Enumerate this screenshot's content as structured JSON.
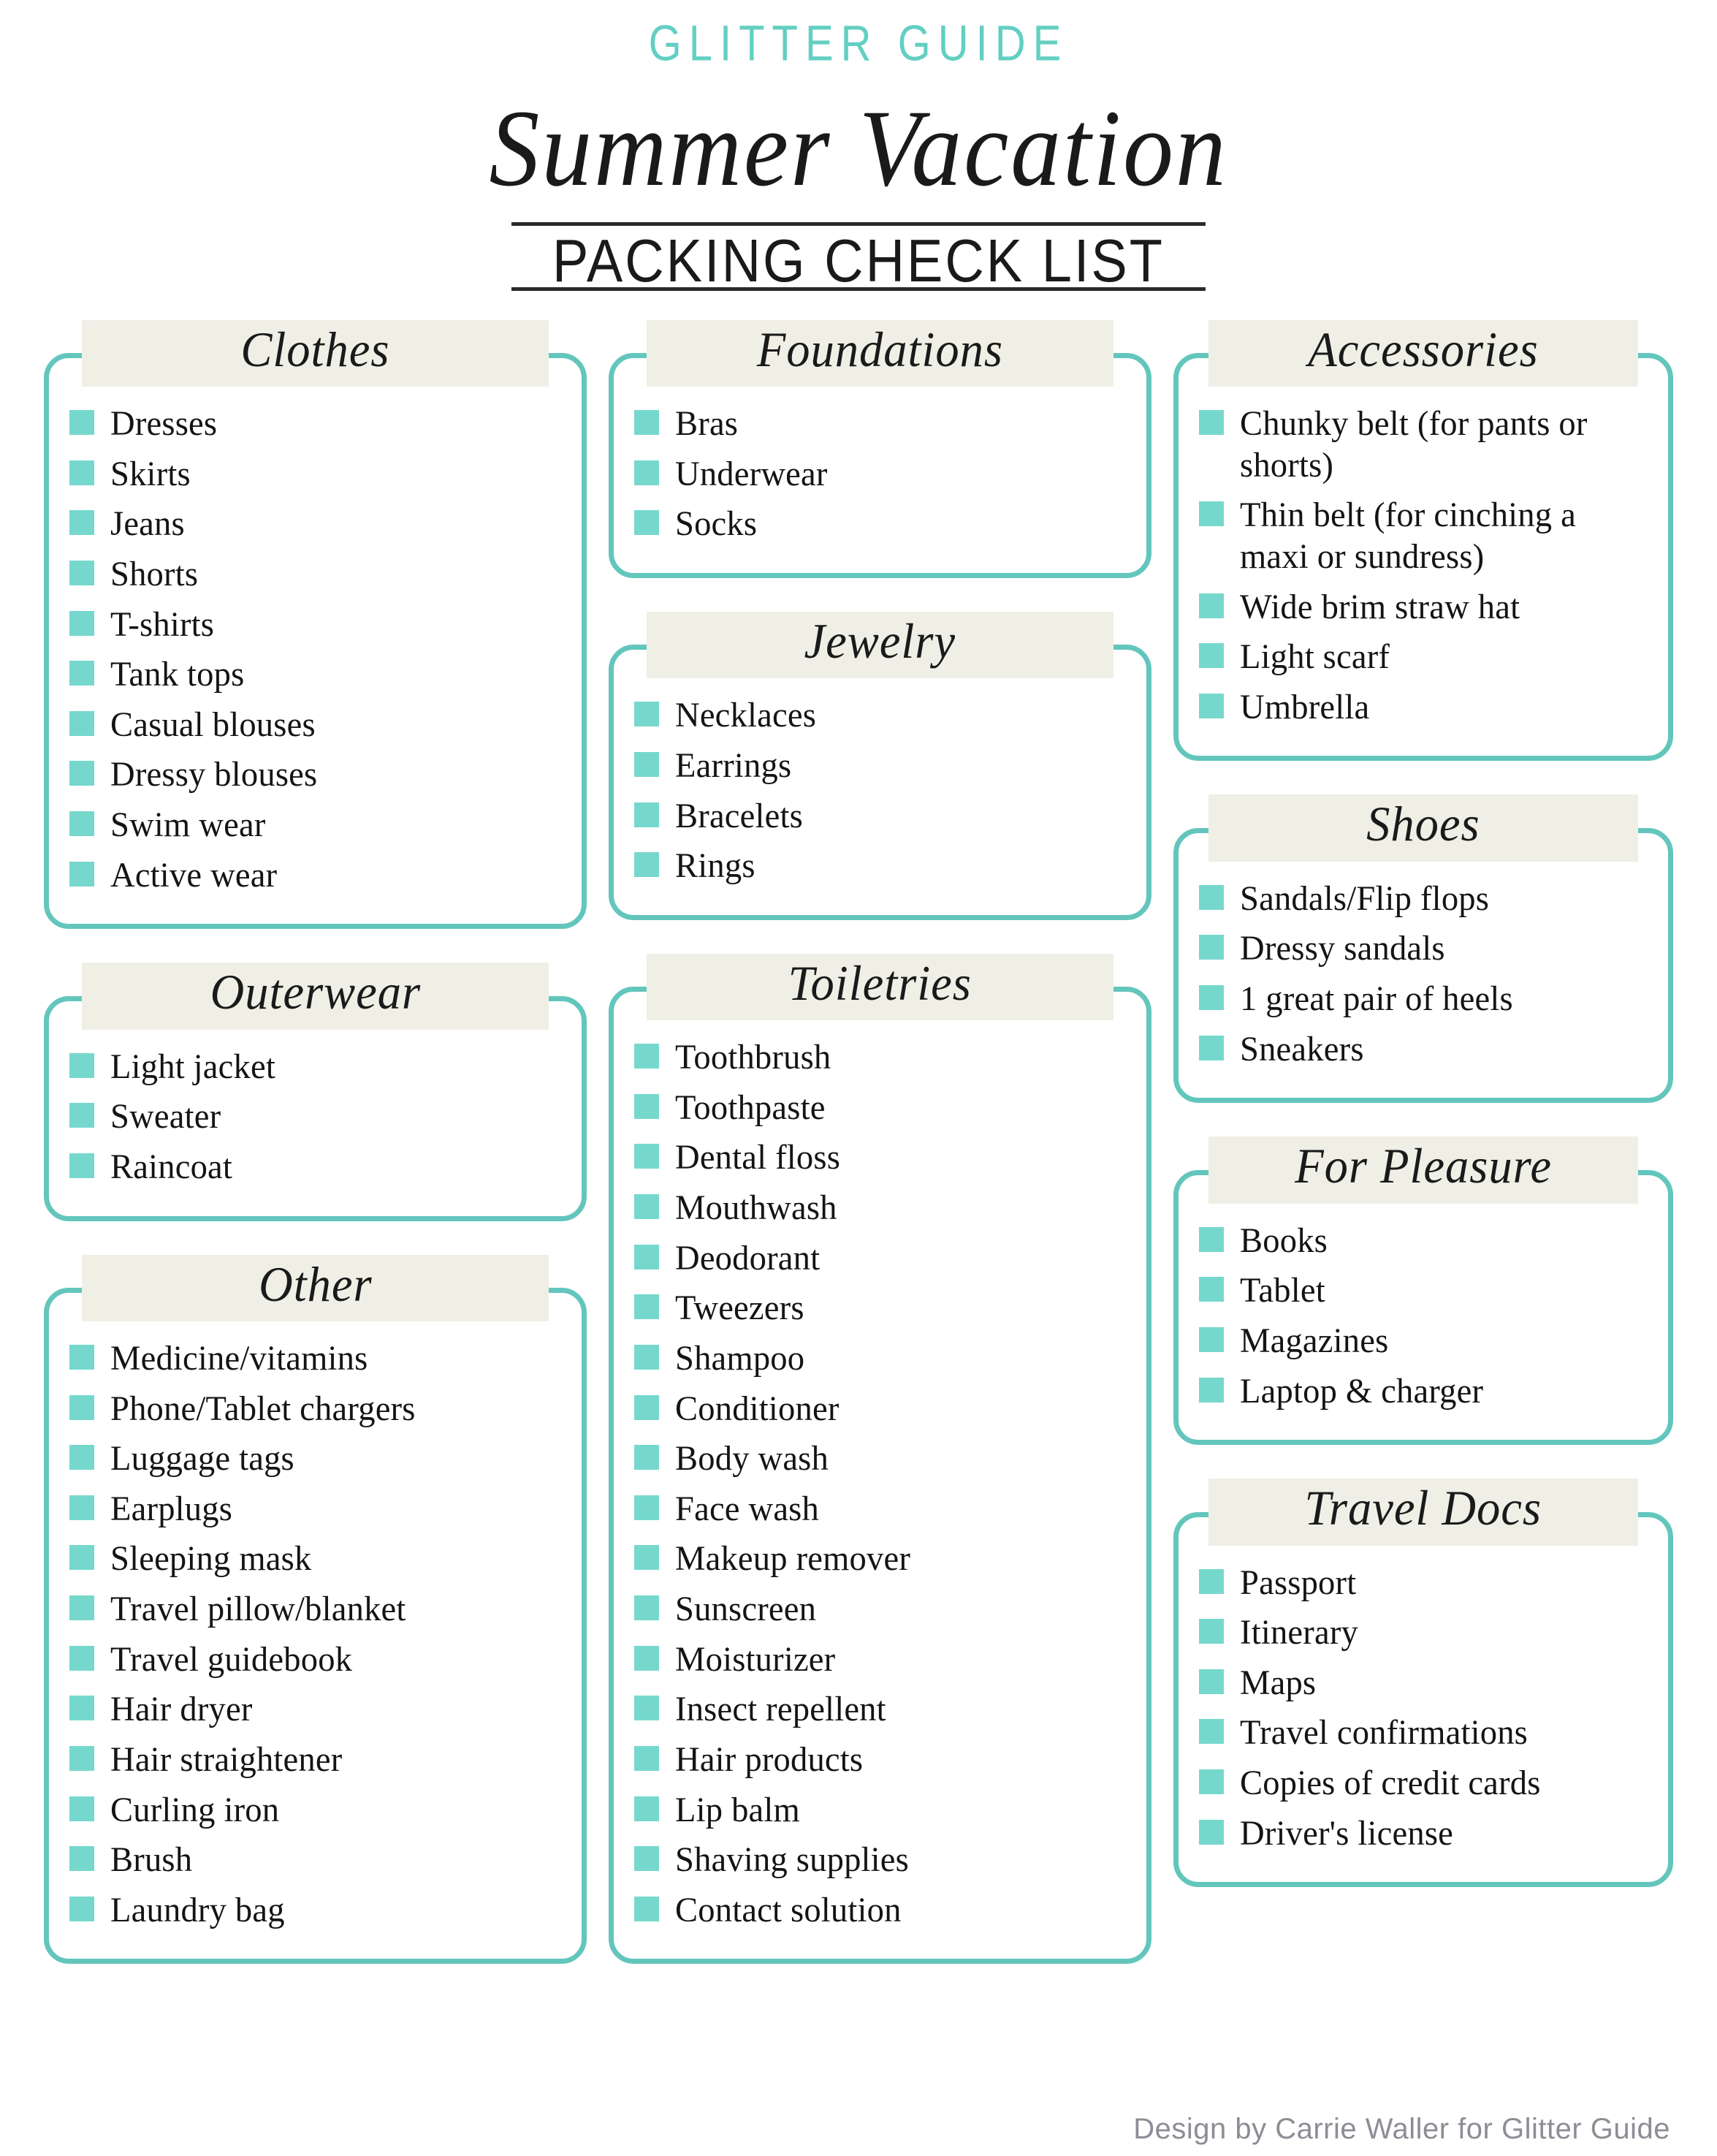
{
  "header": {
    "brand": "GLITTER GUIDE",
    "script_title": "Summer Vacation",
    "subtitle": "PACKING CHECK LIST"
  },
  "colors": {
    "accent_teal": "#63c6bd",
    "checkbox_teal": "#76d8cd",
    "brand_teal": "#62cfc2",
    "header_band": "#f0efe6",
    "text": "#141414",
    "footer_text": "#8d8d96"
  },
  "footer": {
    "credit": "Design by Carrie Waller for Glitter Guide"
  },
  "columns": [
    {
      "sections": [
        {
          "title": "Clothes",
          "items": [
            "Dresses",
            "Skirts",
            "Jeans",
            "Shorts",
            "T-shirts",
            "Tank tops",
            "Casual blouses",
            "Dressy blouses",
            "Swim wear",
            "Active wear"
          ]
        },
        {
          "title": "Outerwear",
          "items": [
            "Light jacket",
            "Sweater",
            "Raincoat"
          ]
        },
        {
          "title": "Other",
          "items": [
            "Medicine/vitamins",
            "Phone/Tablet chargers",
            "Luggage tags",
            "Earplugs",
            "Sleeping mask",
            "Travel pillow/blanket",
            "Travel guidebook",
            "Hair dryer",
            "Hair straightener",
            "Curling iron",
            "Brush",
            "Laundry bag"
          ]
        }
      ]
    },
    {
      "sections": [
        {
          "title": "Foundations",
          "items": [
            "Bras",
            "Underwear",
            "Socks"
          ]
        },
        {
          "title": "Jewelry",
          "items": [
            "Necklaces",
            "Earrings",
            "Bracelets",
            "Rings"
          ]
        },
        {
          "title": "Toiletries",
          "items": [
            "Toothbrush",
            "Toothpaste",
            "Dental floss",
            "Mouthwash",
            "Deodorant",
            "Tweezers",
            "Shampoo",
            "Conditioner",
            "Body wash",
            "Face wash",
            "Makeup remover",
            "Sunscreen",
            "Moisturizer",
            "Insect repellent",
            "Hair products",
            "Lip balm",
            "Shaving supplies",
            "Contact solution"
          ]
        }
      ]
    },
    {
      "sections": [
        {
          "title": "Accessories",
          "items": [
            "Chunky belt (for pants or shorts)",
            "Thin belt (for cinching a maxi or sundress)",
            "Wide brim straw hat",
            "Light scarf",
            "Umbrella"
          ]
        },
        {
          "title": "Shoes",
          "items": [
            "Sandals/Flip flops",
            "Dressy sandals",
            "1 great pair of heels",
            "Sneakers"
          ]
        },
        {
          "title": "For Pleasure",
          "items": [
            "Books",
            "Tablet",
            "Magazines",
            "Laptop & charger"
          ]
        },
        {
          "title": "Travel Docs",
          "items": [
            "Passport",
            "Itinerary",
            "Maps",
            "Travel confirmations",
            "Copies of credit cards",
            "Driver's license"
          ]
        }
      ]
    }
  ]
}
